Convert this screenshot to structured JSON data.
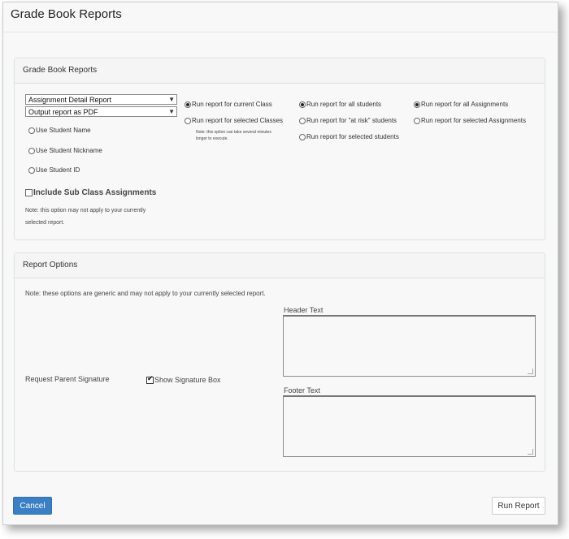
{
  "window": {
    "title": "Grade Book Reports"
  },
  "report_panel": {
    "heading": "Grade Book Reports",
    "report_type": "Assignment Detail Report",
    "output_format": "Output report as PDF",
    "name_options": [
      "Use Student Name",
      "Use Student Nickname",
      "Use Student ID"
    ],
    "include_sub": "Include Sub Class Assignments",
    "note": [
      "Note: this option may not apply to your currently",
      "selected report."
    ],
    "class_options": [
      "Run report for current Class",
      "Run report for selected Classes"
    ],
    "class_note": [
      "Note: this option can take several minutes",
      "longer to execute."
    ],
    "student_options": [
      "Run report for all students",
      "Run report for \"at risk\" students",
      "Run report for selected students"
    ],
    "assignment_options": [
      "Run report for all Assignments",
      "Run report for selected Assignments"
    ]
  },
  "options_panel": {
    "heading": "Report Options",
    "note": "Note: these options are generic and may not apply to your currently selected report.",
    "parent_signature_label": "Request Parent Signature",
    "show_signature": "Show Signature Box",
    "header_label": "Header Text",
    "footer_label": "Footer Text"
  },
  "footer": {
    "cancel": "Cancel",
    "run": "Run Report"
  }
}
